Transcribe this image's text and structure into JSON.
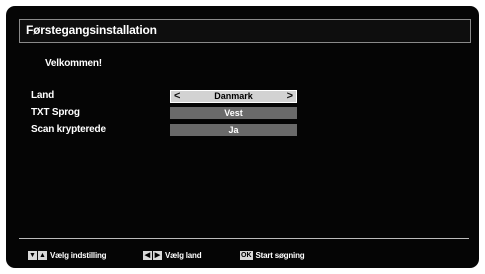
{
  "header": {
    "title": "Førstegangsinstallation"
  },
  "welcome_text": "Velkommen!",
  "settings": [
    {
      "label": "Land",
      "value": "Danmark",
      "selected": true
    },
    {
      "label": "TXT Sprog",
      "value": "Vest",
      "selected": false
    },
    {
      "label": "Scan krypterede",
      "value": "Ja",
      "selected": false
    }
  ],
  "footer": {
    "select_setting": {
      "keys": [
        "▼",
        "▲"
      ],
      "label": "Vælg indstilling"
    },
    "select_country": {
      "keys": [
        "◀",
        "▶"
      ],
      "label": "Vælg land"
    },
    "start_search": {
      "key": "OK",
      "label": "Start søgning"
    }
  },
  "colors": {
    "background": "#050505",
    "selected_field": "#d2d2d2",
    "field": "#6a6a6a"
  }
}
